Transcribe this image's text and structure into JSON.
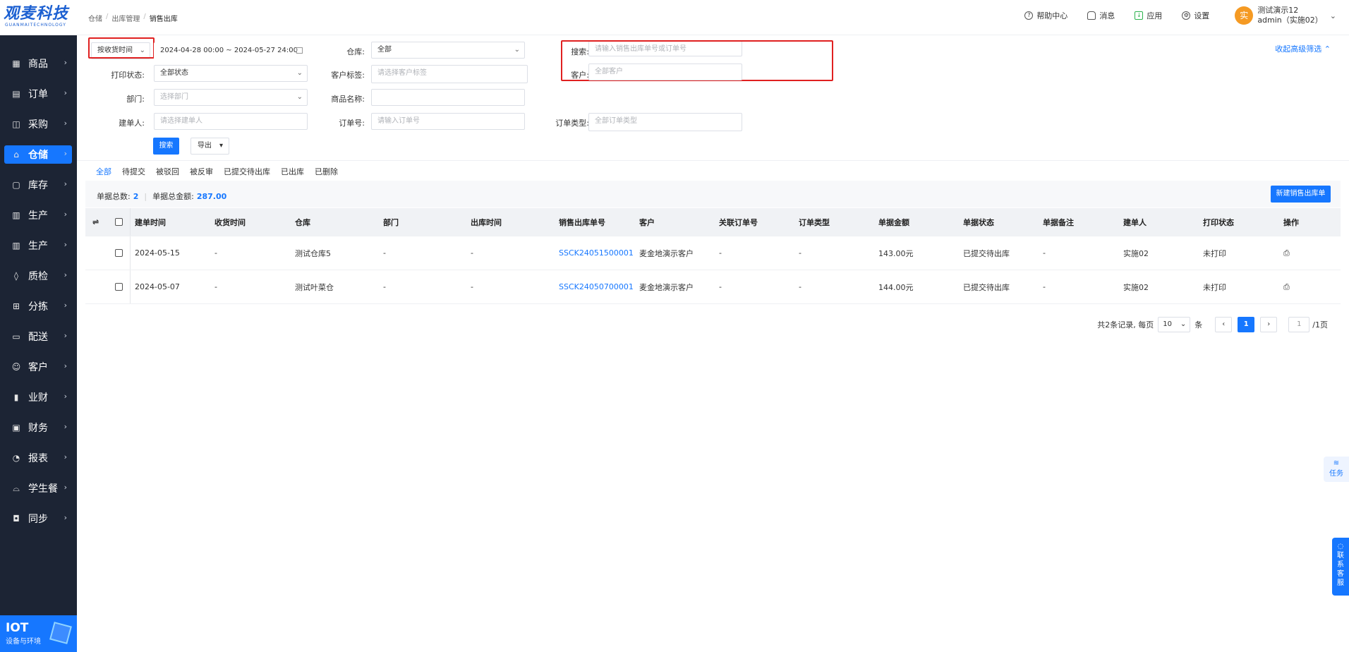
{
  "brand": {
    "name": "观麦科技",
    "sub": "GUANMAITECHNOLOGY"
  },
  "sidebar": {
    "items": [
      {
        "label": "商品",
        "icon": "grid-icon"
      },
      {
        "label": "订单",
        "icon": "clipboard-icon"
      },
      {
        "label": "采购",
        "icon": "bag-icon"
      },
      {
        "label": "仓储",
        "icon": "warehouse-icon",
        "active": true
      },
      {
        "label": "库存",
        "icon": "box-icon"
      },
      {
        "label": "生产",
        "icon": "factory-icon"
      },
      {
        "label": "生产",
        "icon": "factory-icon"
      },
      {
        "label": "质检",
        "icon": "shield-icon"
      },
      {
        "label": "分拣",
        "icon": "sort-icon"
      },
      {
        "label": "配送",
        "icon": "truck-icon"
      },
      {
        "label": "客户",
        "icon": "user-icon"
      },
      {
        "label": "业财",
        "icon": "chart-icon"
      },
      {
        "label": "财务",
        "icon": "wallet-icon"
      },
      {
        "label": "报表",
        "icon": "report-icon"
      },
      {
        "label": "学生餐",
        "icon": "meal-icon"
      },
      {
        "label": "同步",
        "icon": "sync-icon"
      }
    ],
    "iot": {
      "title": "IOT",
      "sub": "设备与环境"
    }
  },
  "header": {
    "breadcrumb": [
      "仓储",
      "出库管理",
      "销售出库"
    ],
    "links": {
      "help": "帮助中心",
      "message": "消息",
      "apps": "应用",
      "settings": "设置"
    },
    "user": {
      "avatar": "实",
      "name": "测试演示12",
      "account": "admin（实施02）"
    }
  },
  "filters": {
    "time_type": "按收货时间",
    "date_range": "2024-04-28 00:00 ~ 2024-05-27 24:00",
    "warehouse_label": "仓库:",
    "warehouse_value": "全部",
    "search_label": "搜索:",
    "search_placeholder": "请输入销售出库单号或订单号",
    "print_status_label": "打印状态:",
    "print_status_value": "全部状态",
    "customer_tag_label": "客户标签:",
    "customer_tag_placeholder": "请选择客户标签",
    "customer_label": "客户:",
    "customer_placeholder": "全部客户",
    "department_label": "部门:",
    "department_placeholder": "选择部门",
    "product_name_label": "商品名称:",
    "creator_label": "建单人:",
    "creator_placeholder": "请选择建单人",
    "order_no_label": "订单号:",
    "order_no_placeholder": "请输入订单号",
    "order_type_label": "订单类型:",
    "order_type_placeholder": "全部订单类型",
    "search_button": "搜索",
    "export_button": "导出",
    "collapse_link": "收起高级筛选"
  },
  "tabs": [
    "全部",
    "待提交",
    "被驳回",
    "被反审",
    "已提交待出库",
    "已出库",
    "已删除"
  ],
  "summary": {
    "count_label": "单据总数:",
    "count": "2",
    "amount_label": "单据总金额:",
    "amount": "287.00",
    "new_button": "新建销售出库单"
  },
  "table": {
    "columns": [
      "建单时间",
      "收货时间",
      "仓库",
      "部门",
      "出库时间",
      "销售出库单号",
      "客户",
      "关联订单号",
      "订单类型",
      "单据金额",
      "单据状态",
      "单据备注",
      "建单人",
      "打印状态",
      "操作"
    ],
    "rows": [
      [
        "2024-05-15",
        "-",
        "测试仓库5",
        "-",
        "-",
        "SSCK24051500001",
        "麦金地演示客户",
        "-",
        "-",
        "143.00元",
        "已提交待出库",
        "-",
        "实施02",
        "未打印"
      ],
      [
        "2024-05-07",
        "-",
        "测试叶菜仓",
        "-",
        "-",
        "SSCK24050700001",
        "麦金地演示客户",
        "-",
        "-",
        "144.00元",
        "已提交待出库",
        "-",
        "实施02",
        "未打印"
      ]
    ]
  },
  "pagination": {
    "total_text": "共2条记录, 每页",
    "page_size": "10",
    "unit": "条",
    "current": "1",
    "jump_value": "1",
    "total_pages": "/1页"
  },
  "floaters": {
    "task": "任务",
    "service": [
      "联",
      "系",
      "客",
      "服"
    ]
  },
  "colors": {
    "primary": "#1677ff",
    "sidebar_bg": "#1c2434",
    "highlight": "#e02020"
  }
}
